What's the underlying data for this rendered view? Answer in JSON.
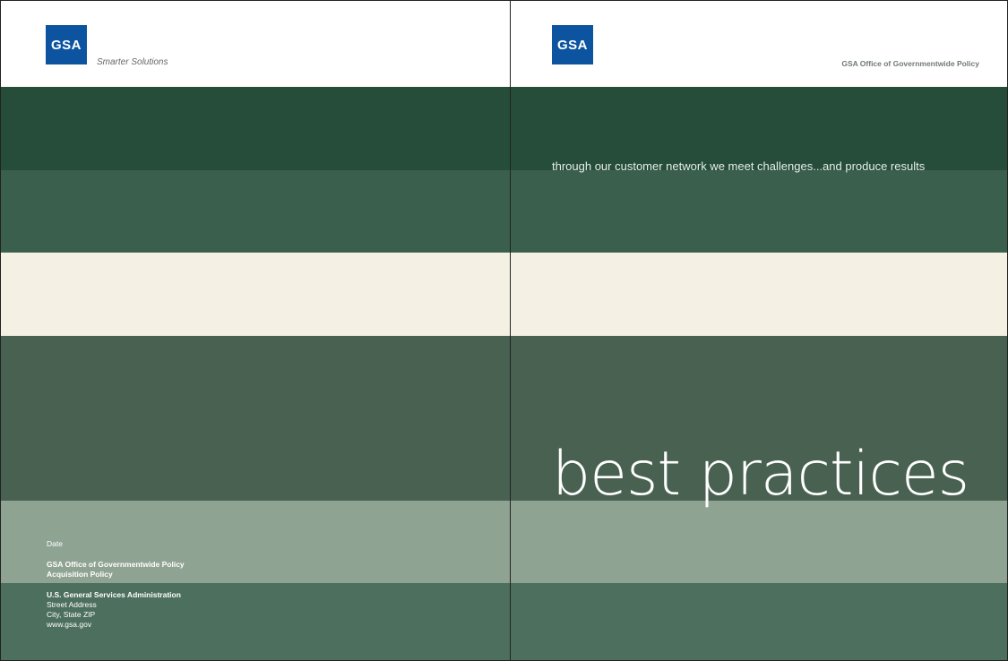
{
  "left_page": {
    "logo_text": "GSA",
    "tagline": "Smarter Solutions",
    "date_label": "Date",
    "office_lines": [
      "GSA Office of Governmentwide Policy",
      "Acquisition Policy"
    ],
    "agency_name": "U.S. General Services Administration",
    "address_lines": [
      "Street Address",
      "City, State ZIP",
      "www.gsa.gov"
    ]
  },
  "right_page": {
    "logo_text": "GSA",
    "office_header": "GSA Office of Governmentwide Policy",
    "headline": "through our customer network we meet challenges...and produce results",
    "title": "best practices"
  },
  "colors": {
    "band_dark": "#254d3a",
    "band_mid": "#3a5f4c",
    "band_cream": "#f4f1e4",
    "band_olive": "#486150",
    "band_sage": "#8fa393",
    "band_bottom": "#4d6f5d",
    "logo_blue": "#0c54a0"
  }
}
